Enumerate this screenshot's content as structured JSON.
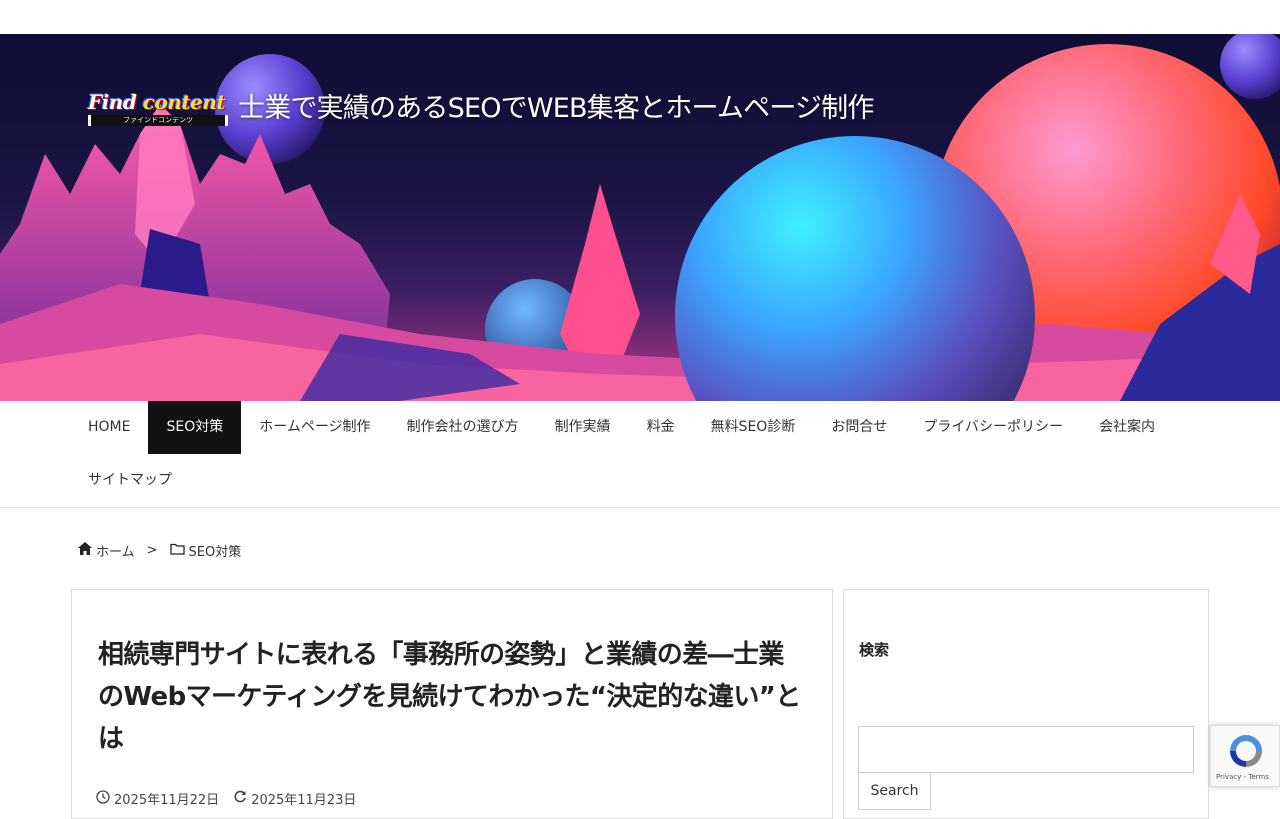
{
  "header": {
    "logo_main_1": "Find",
    "logo_main_2": "content",
    "logo_sub": "ファインドコンテンツ",
    "site_title": "士業で実績のあるSEOでWEB集客とホームページ制作"
  },
  "nav": {
    "items": [
      {
        "label": "HOME"
      },
      {
        "label": "SEO対策",
        "active": true
      },
      {
        "label": "ホームページ制作"
      },
      {
        "label": "制作会社の選び方"
      },
      {
        "label": "制作実績"
      },
      {
        "label": "料金"
      },
      {
        "label": "無料SEO診断"
      },
      {
        "label": "お問合せ"
      },
      {
        "label": "プライバシーポリシー"
      },
      {
        "label": "会社案内"
      },
      {
        "label": "サイトマップ"
      }
    ]
  },
  "breadcrumb": {
    "home": "ホーム",
    "separator": ">",
    "category": "SEO対策"
  },
  "post": {
    "title": "相続専門サイトに表れる「事務所の姿勢」と業績の差―士業のWebマーケティングを見続けてわかった“決定的な違い”とは",
    "published": "2025年11月22日",
    "updated": "2025年11月23日"
  },
  "sidebar": {
    "search_heading": "検索",
    "search_button": "Search",
    "search_value": ""
  },
  "recaptcha": {
    "text": "Privacy - Terms"
  },
  "colors": {
    "nav_active_bg": "#111111",
    "hero_bg": "#1a1546"
  }
}
